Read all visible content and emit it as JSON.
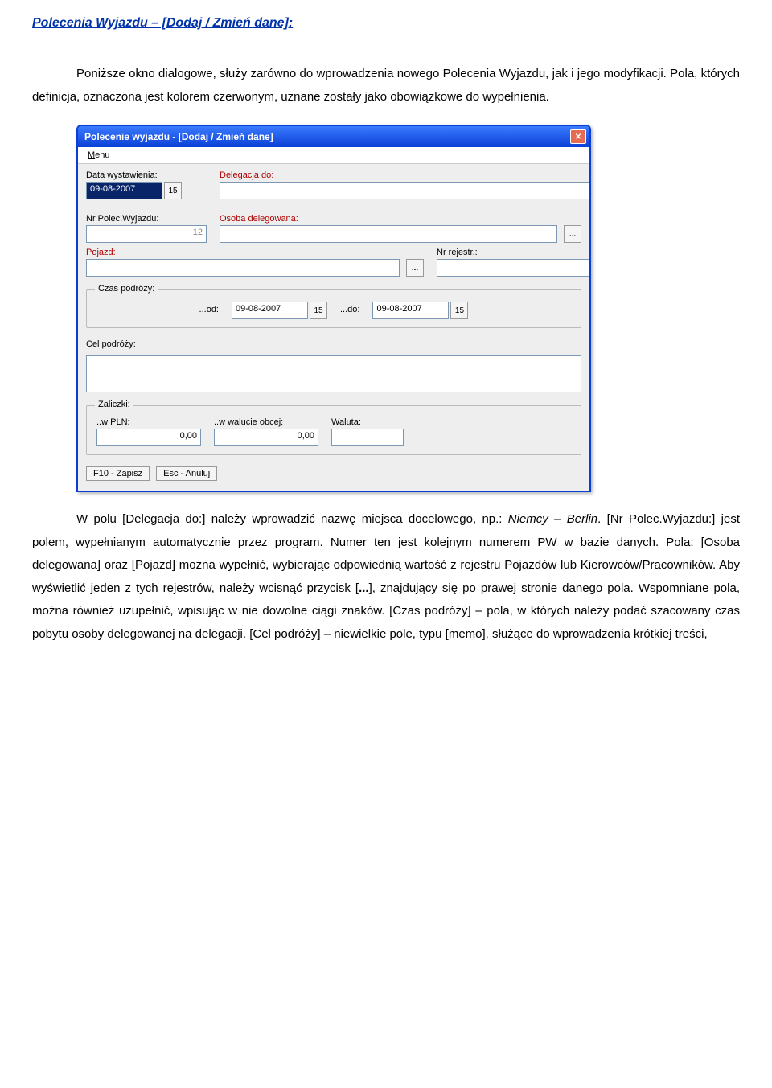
{
  "doc": {
    "heading": "Polecenia Wyjazdu – [Dodaj / Zmień dane]:",
    "para1": "Poniższe okno dialogowe, służy zarówno do wprowadzenia nowego Polecenia Wyjazdu, jak i jego modyfikacji. Pola, których definicja, oznaczona jest kolorem czerwonym, uznane zostały jako obowiązkowe do wypełnienia.",
    "para2_a": "W polu [Delegacja do:] należy wprowadzić nazwę miejsca docelowego, np.: ",
    "para2_italic": "Niemcy – Berlin",
    "para2_b": ". [Nr Polec.Wyjazdu:] jest polem, wypełnianym automatycznie przez program. Numer ten jest kolejnym numerem PW w bazie danych. Pola: [Osoba delegowana] oraz [Pojazd] można wypełnić, wybierając odpowiednią wartość z rejestru Pojazdów lub Kierowców/Pracowników. Aby wyświetlić jeden z tych rejestrów, należy wcisnąć przycisk [",
    "para2_bold": "...",
    "para2_c": "], znajdujący się po prawej stronie danego pola. Wspomniane pola, można również uzupełnić, wpisując w nie dowolne ciągi znaków. [Czas podróży] – pola, w których należy podać szacowany czas pobytu osoby delegowanej na delegacji. [Cel podróży] – niewielkie pole, typu [memo], służące do wprowadzenia krótkiej treści,"
  },
  "dialog": {
    "title": "Polecenie wyjazdu - [Dodaj / Zmień dane]",
    "menu": "Menu",
    "labels": {
      "data_wyst": "Data wystawienia:",
      "delegacja_do": "Delegacja do:",
      "nr_polec": "Nr Polec.Wyjazdu:",
      "osoba_deleg": "Osoba delegowana:",
      "pojazd": "Pojazd:",
      "nr_rejestr": "Nr rejestr.:",
      "czas_podrozy": "Czas podróży:",
      "od": "...od:",
      "do": "...do:",
      "cel_podrozy": "Cel podróży:",
      "zaliczki": "Zaliczki:",
      "w_pln": "..w PLN:",
      "w_walucie": "..w walucie obcej:",
      "waluta": "Waluta:"
    },
    "values": {
      "data_wyst": "09-08-2007",
      "nr_polec": "12",
      "od": "09-08-2007",
      "do": "09-08-2007",
      "w_pln": "0,00",
      "w_walucie": "0,00",
      "dots": "...",
      "cal_icon": "15"
    },
    "buttons": {
      "save": "F10 - Zapisz",
      "cancel": "Esc - Anuluj"
    }
  }
}
